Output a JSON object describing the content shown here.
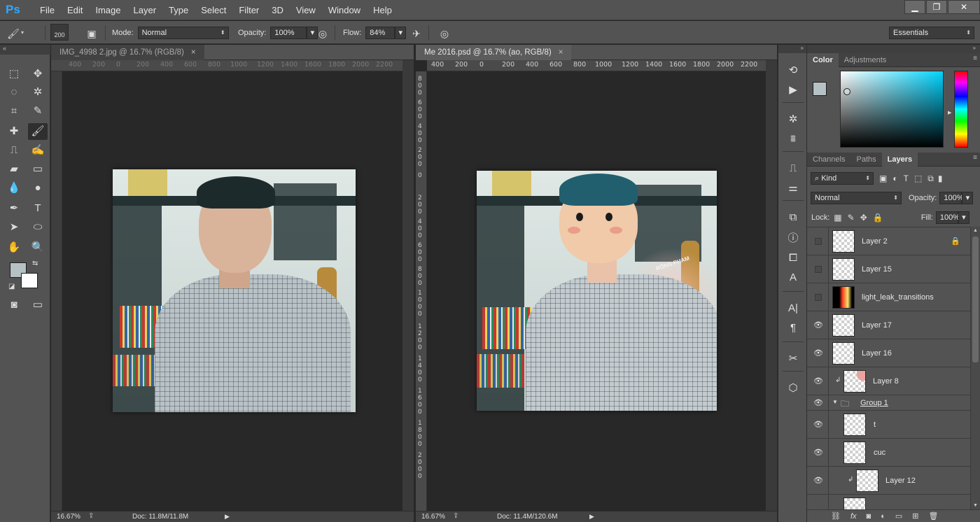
{
  "app": {
    "logo": "Ps"
  },
  "menu": [
    "File",
    "Edit",
    "Image",
    "Layer",
    "Type",
    "Select",
    "Filter",
    "3D",
    "View",
    "Window",
    "Help"
  ],
  "window_controls": [
    "▁",
    "❐",
    "✕"
  ],
  "options": {
    "brush_size": "200",
    "mode_label": "Mode:",
    "mode_value": "Normal",
    "opacity_label": "Opacity:",
    "opacity_value": "100%",
    "flow_label": "Flow:",
    "flow_value": "84%",
    "workspace": "Essentials"
  },
  "documents": [
    {
      "tab": "IMG_4998 2.jpg @ 16.7% (RGB/8)",
      "close": "×",
      "ruler": [
        "400",
        "200",
        "0",
        "200",
        "400",
        "600",
        "800",
        "1000",
        "1200",
        "1400",
        "1600",
        "1800",
        "2000",
        "2200"
      ],
      "zoom": "16.67%",
      "doc_info": "Doc: 11.8M/11.8M"
    },
    {
      "tab": "Me 2016.psd @ 16.7% (ao, RGB/8)",
      "close": "×",
      "ruler": [
        "400",
        "200",
        "0",
        "200",
        "400",
        "600",
        "800",
        "1000",
        "1200",
        "1400",
        "1600",
        "1800",
        "2000",
        "2200"
      ],
      "vruler": [
        "8",
        "0",
        "0",
        "6",
        "0",
        "0",
        "4",
        "0",
        "0",
        "2",
        "0",
        "0",
        "0",
        "2",
        "0",
        "0",
        "4",
        "0",
        "0",
        "6",
        "0",
        "0",
        "8",
        "0",
        "0",
        "1",
        "0",
        "0",
        "0",
        "1",
        "2",
        "0",
        "0",
        "1",
        "4",
        "0",
        "0",
        "1",
        "6",
        "0",
        "0",
        "1",
        "8",
        "0",
        "0",
        "2",
        "0",
        "0",
        "0"
      ],
      "zoom": "16.67%",
      "doc_info": "Doc: 11.4M/120.6M",
      "signature": "RỒNG PHAM"
    }
  ],
  "color_panel": {
    "tabs": [
      "Color",
      "Adjustments"
    ],
    "foreground": "#b5c1c5",
    "background": "#ffffff",
    "hue": "#00d4ff"
  },
  "layers_panel": {
    "tabs": [
      "Channels",
      "Paths",
      "Layers"
    ],
    "filter": "Kind",
    "blend_mode": "Normal",
    "opacity_label": "Opacity:",
    "opacity_value": "100%",
    "lock_label": "Lock:",
    "fill_label": "Fill:",
    "fill_value": "100%",
    "layers": [
      {
        "name": "Layer 2",
        "visible": false,
        "locked": true
      },
      {
        "name": "Layer 15",
        "visible": false
      },
      {
        "name": "light_leak_transitions",
        "visible": false
      },
      {
        "name": "Layer 17",
        "visible": true
      },
      {
        "name": "Layer 16",
        "visible": true
      },
      {
        "name": "Layer 8",
        "visible": true,
        "clipped": true
      },
      {
        "name": "Group 1",
        "visible": true,
        "group": true
      },
      {
        "name": "t",
        "visible": true
      },
      {
        "name": "cuc",
        "visible": true
      },
      {
        "name": "Layer 12",
        "visible": true,
        "clipped": true
      }
    ],
    "footer_icons": [
      "link-icon",
      "fx-icon",
      "mask-icon",
      "adjustment-icon",
      "folder-icon",
      "new-layer-icon",
      "trash-icon"
    ],
    "footer_labels": [
      "⛓",
      "fx",
      "◙",
      "◐",
      "▭",
      "⊞",
      "🗑"
    ]
  }
}
